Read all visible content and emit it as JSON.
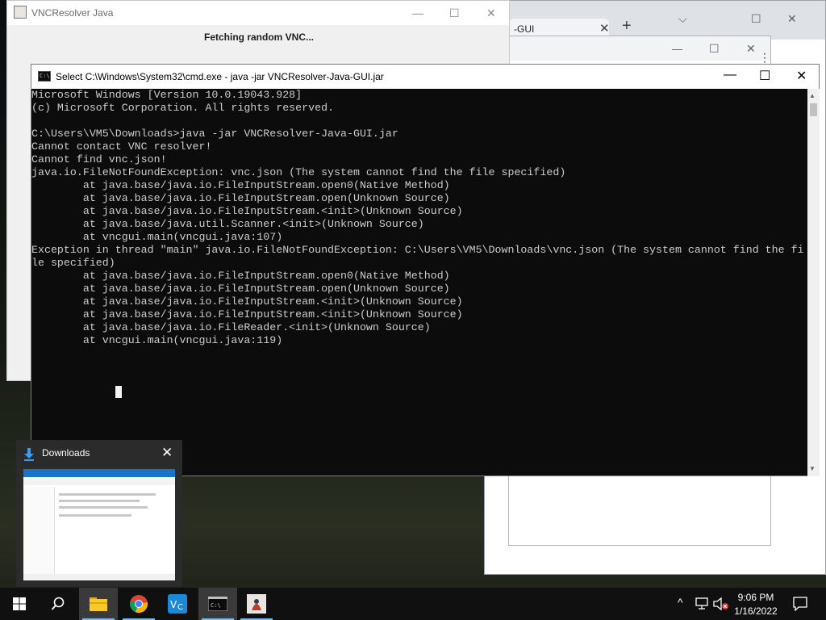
{
  "chrome": {
    "tab_title": "-GUI",
    "tab_close": "✕",
    "new_tab": "+",
    "ctrl_dropdown": "⌵",
    "ctrl_maximize": "☐",
    "ctrl_close": "✕"
  },
  "chrome2": {
    "ctrl_minimize": "—",
    "ctrl_maximize": "☐",
    "ctrl_close": "✕"
  },
  "java_window": {
    "title": "VNCResolver Java",
    "status": "Fetching random VNC...",
    "ctrl_minimize": "—",
    "ctrl_maximize": "☐",
    "ctrl_close": "✕"
  },
  "cmd_window": {
    "title": "Select C:\\Windows\\System32\\cmd.exe - java  -jar VNCResolver-Java-GUI.jar",
    "icon_text": "C:\\",
    "ctrl_minimize": "—",
    "ctrl_maximize": "☐",
    "ctrl_close": "✕",
    "lines": [
      "Microsoft Windows [Version 10.0.19043.928]",
      "(c) Microsoft Corporation. All rights reserved.",
      "",
      "C:\\Users\\VM5\\Downloads>java -jar VNCResolver-Java-GUI.jar",
      "Cannot contact VNC resolver!",
      "Cannot find vnc.json!",
      "java.io.FileNotFoundException: vnc.json (The system cannot find the file specified)",
      "        at java.base/java.io.FileInputStream.open0(Native Method)",
      "        at java.base/java.io.FileInputStream.open(Unknown Source)",
      "        at java.base/java.io.FileInputStream.<init>(Unknown Source)",
      "        at java.base/java.util.Scanner.<init>(Unknown Source)",
      "        at vncgui.main(vncgui.java:107)",
      "Exception in thread \"main\" java.io.FileNotFoundException: C:\\Users\\VM5\\Downloads\\vnc.json (The system cannot find the fi",
      "le specified)",
      "        at java.base/java.io.FileInputStream.open0(Native Method)",
      "        at java.base/java.io.FileInputStream.open(Unknown Source)",
      "        at java.base/java.io.FileInputStream.<init>(Unknown Source)",
      "        at java.base/java.io.FileInputStream.<init>(Unknown Source)",
      "        at java.base/java.io.FileReader.<init>(Unknown Source)",
      "        at vncgui.main(vncgui.java:119)"
    ]
  },
  "thumbnail": {
    "title": "Downloads",
    "close": "✕"
  },
  "taskbar": {
    "items": [
      {
        "name": "start-button",
        "icon": "windows-logo-icon"
      },
      {
        "name": "search-button",
        "icon": "search-icon"
      },
      {
        "name": "file-explorer-taskbar-button",
        "icon": "folder-icon"
      },
      {
        "name": "chrome-taskbar-button",
        "icon": "chrome-icon"
      },
      {
        "name": "vnc-taskbar-button",
        "icon": "vnc-icon"
      },
      {
        "name": "cmd-taskbar-button",
        "icon": "terminal-icon"
      },
      {
        "name": "java-taskbar-button",
        "icon": "java-icon"
      }
    ],
    "tray_chevron": "^",
    "time": "9:06 PM",
    "date": "1/16/2022",
    "colors": {
      "bar": "#101010",
      "accent": "#76b9ed"
    }
  }
}
